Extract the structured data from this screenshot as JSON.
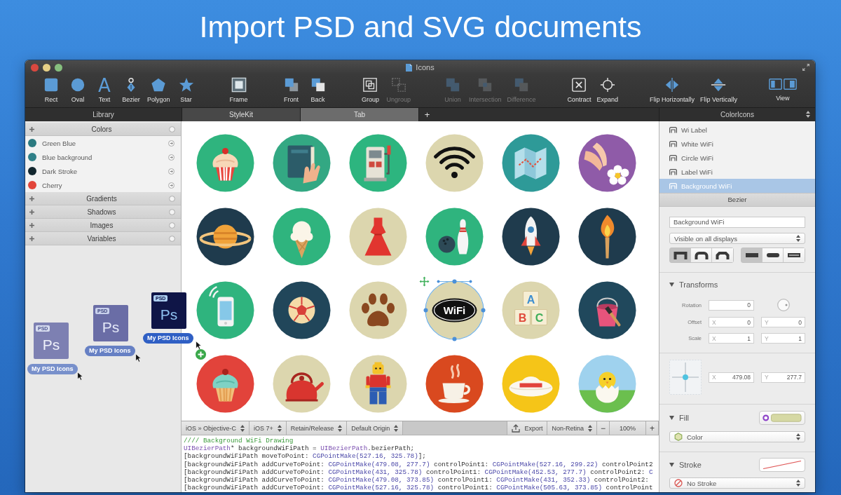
{
  "headline": "Import PSD and SVG documents",
  "window": {
    "title": "Icons"
  },
  "toolbar": {
    "groups": [
      [
        {
          "kind": "rect",
          "label": "Rect",
          "disabled": false
        },
        {
          "kind": "oval",
          "label": "Oval",
          "disabled": false
        },
        {
          "kind": "text",
          "label": "Text",
          "glyph": "A",
          "disabled": false
        },
        {
          "kind": "bezier",
          "label": "Bezier",
          "disabled": false
        },
        {
          "kind": "polygon",
          "label": "Polygon",
          "disabled": false
        },
        {
          "kind": "star",
          "label": "Star",
          "disabled": false
        }
      ],
      [
        {
          "kind": "frame",
          "label": "Frame",
          "disabled": false
        }
      ],
      [
        {
          "kind": "front",
          "label": "Front",
          "disabled": false
        },
        {
          "kind": "back",
          "label": "Back",
          "disabled": false
        }
      ],
      [
        {
          "kind": "group",
          "label": "Group",
          "disabled": false
        },
        {
          "kind": "ungroup",
          "label": "Ungroup",
          "disabled": true
        }
      ],
      [
        {
          "kind": "union",
          "label": "Union",
          "disabled": true
        },
        {
          "kind": "intersection",
          "label": "Intersection",
          "disabled": true
        },
        {
          "kind": "difference",
          "label": "Difference",
          "disabled": true
        }
      ],
      [
        {
          "kind": "contract",
          "label": "Contract",
          "disabled": false
        },
        {
          "kind": "expand",
          "label": "Expand",
          "disabled": false
        }
      ],
      [
        {
          "kind": "flip_h",
          "label": "Flip Horizontally",
          "disabled": false
        },
        {
          "kind": "flip_v",
          "label": "Flip Vertically",
          "disabled": false
        }
      ],
      [
        {
          "kind": "view",
          "label": "View",
          "disabled": false
        }
      ]
    ]
  },
  "tabs": {
    "library_title": "Library",
    "items": [
      {
        "label": "StyleKit",
        "selected": false
      },
      {
        "label": "Tab",
        "selected": true
      }
    ],
    "add": "+",
    "inspector_title": "ColorIcons"
  },
  "library": {
    "sections": [
      {
        "title": "Colors",
        "items": [
          {
            "name": "Green Blue",
            "color": "#2b7a80"
          },
          {
            "name": "Blue background",
            "color": "#2f8088"
          },
          {
            "name": "Dark Stroke",
            "color": "#12262e"
          },
          {
            "name": "Cherry",
            "color": "#e2453a"
          }
        ]
      },
      {
        "title": "Gradients"
      },
      {
        "title": "Shadows"
      },
      {
        "title": "Images"
      },
      {
        "title": "Variables"
      }
    ]
  },
  "drag": {
    "files": [
      {
        "kind": "faint",
        "badge": "PSD",
        "logo": "Ps",
        "label": "My PSD Icons"
      },
      {
        "kind": "ghost",
        "badge": "PSD",
        "logo": "Ps",
        "label": "My PSD Icons"
      },
      {
        "kind": "dragged",
        "badge": "PSD",
        "logo": "Ps",
        "label": "My PSD Icons"
      }
    ]
  },
  "canvas": {
    "items": [
      {
        "kind": "cupcake",
        "color": "#2fb47e",
        "selected": false
      },
      {
        "kind": "book",
        "color": "#33a883",
        "selected": false
      },
      {
        "kind": "gas_pump",
        "color": "#2db57f",
        "selected": false
      },
      {
        "kind": "wifi",
        "color": "#dcd6ae",
        "selected": false
      },
      {
        "kind": "map",
        "color": "#2e9a98",
        "selected": false
      },
      {
        "kind": "hands_flower",
        "color": "#8f5ba8",
        "selected": false
      },
      {
        "kind": "planet",
        "color": "#1f3b4d",
        "selected": false
      },
      {
        "kind": "ice_cream",
        "color": "#2fb47e",
        "selected": false
      },
      {
        "kind": "dress",
        "color": "#dcd6ae",
        "selected": false
      },
      {
        "kind": "bowling",
        "color": "#2fb47e",
        "selected": false
      },
      {
        "kind": "rocket",
        "color": "#1f3b4d",
        "selected": false
      },
      {
        "kind": "torch",
        "color": "#1f3b4d",
        "selected": false
      },
      {
        "kind": "phone",
        "color": "#2fb47e",
        "selected": false
      },
      {
        "kind": "soccer",
        "color": "#21465a",
        "selected": false
      },
      {
        "kind": "paw",
        "color": "#dcd6ae",
        "selected": false
      },
      {
        "kind": "wifi_badge",
        "color": "#dcd6ae",
        "selected": true,
        "label": "WiFi"
      },
      {
        "kind": "blocks",
        "color": "#dcd6ae",
        "selected": false,
        "letters": [
          "A",
          "B",
          "C"
        ]
      },
      {
        "kind": "paint_bucket",
        "color": "#20485c",
        "selected": false
      },
      {
        "kind": "cupcake_mint",
        "color": "#e2433b",
        "selected": false
      },
      {
        "kind": "kettle",
        "color": "#dcd6ae",
        "selected": false
      },
      {
        "kind": "figure",
        "color": "#dcd6ae",
        "selected": false
      },
      {
        "kind": "coffee",
        "color": "#d9491f",
        "selected": false
      },
      {
        "kind": "hat",
        "color": "#f5c518",
        "selected": false
      },
      {
        "kind": "chick",
        "color": "#9fd2ee",
        "selected": false
      }
    ]
  },
  "code": {
    "toolbar_left": [
      {
        "kind": "dropdown",
        "label": "iOS » Objective-C"
      },
      {
        "kind": "dropdown",
        "label": "iOS 7+"
      },
      {
        "kind": "dropdown",
        "label": "Retain/Release"
      },
      {
        "kind": "dropdown",
        "label": "Default Origin"
      }
    ],
    "toolbar_right": [
      {
        "kind": "export",
        "label": "Export"
      },
      {
        "kind": "dropdown",
        "label": "Non-Retina"
      },
      {
        "kind": "decrease",
        "label": "−"
      },
      {
        "kind": "value",
        "label": "100%"
      },
      {
        "kind": "increase",
        "label": "+"
      }
    ],
    "lines": [
      {
        "parts": [
          {
            "kind": "comment",
            "text": "//// Background WiFi Drawing"
          }
        ]
      },
      {
        "parts": [
          {
            "kind": "type",
            "text": "UIBezierPath"
          },
          {
            "kind": "plain",
            "text": "* backgroundWiFiPath = "
          },
          {
            "kind": "type",
            "text": "UIBezierPath"
          },
          {
            "kind": "plain",
            "text": ".bezierPath;"
          }
        ]
      },
      {
        "parts": [
          {
            "kind": "plain",
            "text": "[backgroundWiFiPath moveToPoint: "
          },
          {
            "kind": "call",
            "text": "CGPointMake(527.16, 325.78)"
          },
          {
            "kind": "plain",
            "text": "];"
          }
        ]
      },
      {
        "parts": [
          {
            "kind": "plain",
            "text": "[backgroundWiFiPath addCurveToPoint: "
          },
          {
            "kind": "call",
            "text": "CGPointMake(479.08, 277.7)"
          },
          {
            "kind": "plain",
            "text": " controlPoint1: "
          },
          {
            "kind": "call",
            "text": "CGPointMake(527.16, 299.22)"
          },
          {
            "kind": "plain",
            "text": " controlPoint2"
          }
        ]
      },
      {
        "parts": [
          {
            "kind": "plain",
            "text": "[backgroundWiFiPath addCurveToPoint: "
          },
          {
            "kind": "call",
            "text": "CGPointMake(431, 325.78)"
          },
          {
            "kind": "plain",
            "text": " controlPoint1: "
          },
          {
            "kind": "call",
            "text": "CGPointMake(452.53, 277.7)"
          },
          {
            "kind": "plain",
            "text": " controlPoint2: "
          },
          {
            "kind": "call",
            "text": "C"
          }
        ]
      },
      {
        "parts": [
          {
            "kind": "plain",
            "text": "[backgroundWiFiPath addCurveToPoint: "
          },
          {
            "kind": "call",
            "text": "CGPointMake(479.08, 373.85)"
          },
          {
            "kind": "plain",
            "text": " controlPoint1: "
          },
          {
            "kind": "call",
            "text": "CGPointMake(431, 352.33)"
          },
          {
            "kind": "plain",
            "text": " controlPoint2:"
          }
        ]
      },
      {
        "parts": [
          {
            "kind": "plain",
            "text": "[backgroundWiFiPath addCurveToPoint: "
          },
          {
            "kind": "call",
            "text": "CGPointMake(527.16, 325.78)"
          },
          {
            "kind": "plain",
            "text": " controlPoint1: "
          },
          {
            "kind": "call",
            "text": "CGPointMake(505.63, 373.85)"
          },
          {
            "kind": "plain",
            "text": " controlPoint"
          }
        ]
      }
    ]
  },
  "inspector": {
    "layers": [
      {
        "name": "Wi Label",
        "selected": false
      },
      {
        "name": "White WiFi",
        "selected": false
      },
      {
        "name": "Circle WiFi",
        "selected": false
      },
      {
        "name": "Label WiFi",
        "selected": false
      },
      {
        "name": "Background WiFi",
        "selected": true
      }
    ],
    "section": "Bezier",
    "name_field": {
      "value": "Background WiFi"
    },
    "visibility": {
      "value": "Visible on all displays"
    },
    "segment_groups": [
      {
        "items": [
          {
            "kind": "miter",
            "selected": true
          },
          {
            "kind": "round",
            "selected": false
          },
          {
            "kind": "bevel",
            "selected": false
          }
        ]
      },
      {
        "items": [
          {
            "kind": "butt",
            "selected": true
          },
          {
            "kind": "round_cap",
            "selected": false
          },
          {
            "kind": "square",
            "selected": false
          }
        ]
      }
    ],
    "transforms": {
      "title": "Transforms",
      "rotation": {
        "label": "Rotation",
        "value": "0"
      },
      "offset": {
        "label": "Offset",
        "x": {
          "prefix": "X",
          "value": "0"
        },
        "y": {
          "prefix": "Y",
          "value": "0"
        }
      },
      "scale": {
        "label": "Scale",
        "x": {
          "prefix": "X",
          "value": "1"
        },
        "y": {
          "prefix": "Y",
          "value": "1"
        }
      }
    },
    "origin": {
      "x": {
        "prefix": "X",
        "value": "479.08"
      },
      "y": {
        "prefix": "Y",
        "value": "277.7"
      }
    },
    "fill": {
      "title": "Fill",
      "mode": "Color"
    },
    "stroke": {
      "title": "Stroke",
      "mode": "No Stroke"
    }
  }
}
